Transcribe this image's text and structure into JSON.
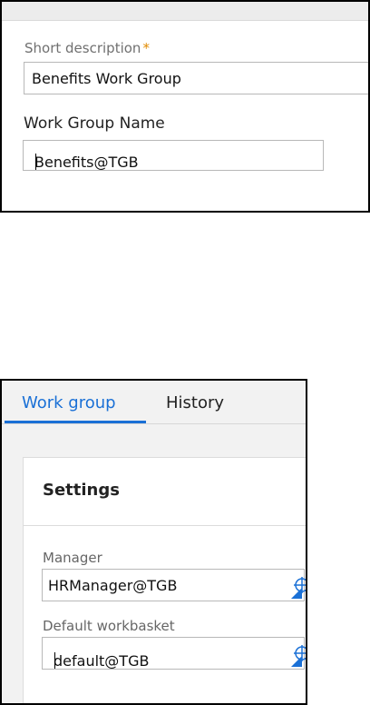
{
  "panel1": {
    "short_description_label": "Short description",
    "required_marker": "*",
    "short_description_value": "Benefits Work Group",
    "work_group_name_label": "Work Group Name",
    "work_group_name_value": "Benefits@TGB"
  },
  "panel2": {
    "tabs": [
      {
        "label": "Work group",
        "active": true
      },
      {
        "label": "History",
        "active": false
      }
    ],
    "section_title": "Settings",
    "manager_label": "Manager",
    "manager_value": "HRManager@TGB",
    "workbasket_label": "Default workbasket",
    "workbasket_value": "default@TGB"
  },
  "icons": {
    "lookup": "crosshair-icon",
    "dropdown": "triangle-corner-icon"
  },
  "colors": {
    "accent": "#1a70d6",
    "required": "#e08a00"
  }
}
